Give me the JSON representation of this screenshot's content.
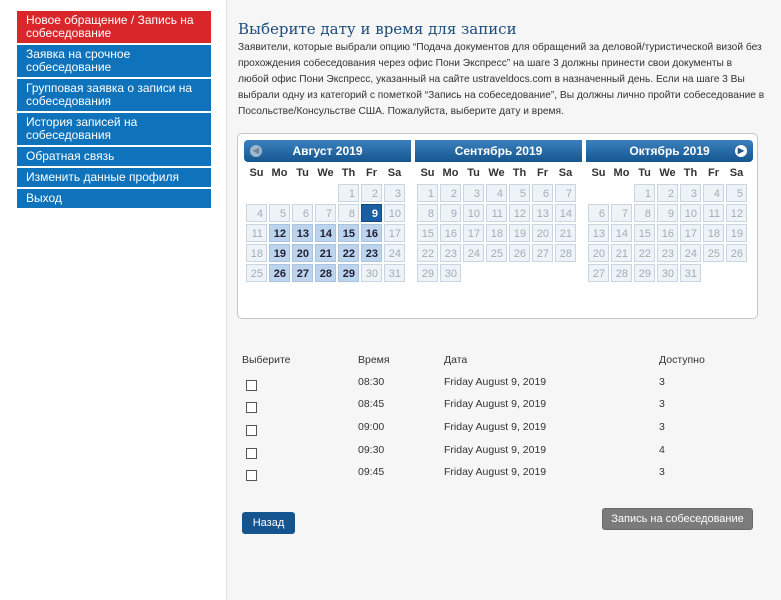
{
  "sidebar": {
    "items": [
      {
        "label": "Новое обращение / Запись на собеседование",
        "active": true
      },
      {
        "label": "Заявка на срочное собеседование",
        "active": false
      },
      {
        "label": "Групповая заявка о записи на собеседования",
        "active": false
      },
      {
        "label": "История записей на собеседования",
        "active": false
      },
      {
        "label": "Обратная связь",
        "active": false
      },
      {
        "label": "Изменить данные профиля",
        "active": false
      },
      {
        "label": "Выход",
        "active": false
      }
    ]
  },
  "main": {
    "title": "Выберите дату и время для записи",
    "description": "Заявители, которые выбрали опцию “Подача документов для обращений за деловой/туристической визой без прохождения собеседования через офис Пони Экспресс” на шаге 3 должны принести свои документы в любой офис Пони Экспресс, указанный на сайте ustraveldocs.com в назначенный день. Если на шаге 3 Вы выбрали одну из категорий с пометкой “Запись на собеседование”, Вы должны лично пройти собеседование в Посольстве/Консульстве США. Пожалуйста, выберите дату и время."
  },
  "calendar": {
    "weekdays": [
      "Su",
      "Mo",
      "Tu",
      "We",
      "Th",
      "Fr",
      "Sa"
    ],
    "months": [
      {
        "title": "Август 2019",
        "first_weekday": 4,
        "days_in_month": 31,
        "available": [
          12,
          13,
          14,
          15,
          16,
          19,
          20,
          21,
          22,
          23,
          26,
          27,
          28,
          29
        ],
        "selected": 9
      },
      {
        "title": "Сентябрь 2019",
        "first_weekday": 0,
        "days_in_month": 30,
        "available": [],
        "selected": null
      },
      {
        "title": "Октябрь 2019",
        "first_weekday": 2,
        "days_in_month": 31,
        "available": [],
        "selected": null
      }
    ],
    "prev_icon": "circle-arrow-left-icon",
    "next_icon": "circle-arrow-right-icon"
  },
  "slots": {
    "headers": {
      "select": "Выберите",
      "time": "Время",
      "date": "Дата",
      "available": "Доступно"
    },
    "rows": [
      {
        "time": "08:30",
        "date": "Friday August 9, 2019",
        "available": "3"
      },
      {
        "time": "08:45",
        "date": "Friday August 9, 2019",
        "available": "3"
      },
      {
        "time": "09:00",
        "date": "Friday August 9, 2019",
        "available": "3"
      },
      {
        "time": "09:30",
        "date": "Friday August 9, 2019",
        "available": "4"
      },
      {
        "time": "09:45",
        "date": "Friday August 9, 2019",
        "available": "3"
      }
    ]
  },
  "buttons": {
    "back": "Назад",
    "book": "Запись на собеседование"
  },
  "colors": {
    "sidebar_bg": "#0e73bb",
    "sidebar_active": "#d9262a",
    "title": "#1d4b7c",
    "calendar_header": "#15568f",
    "day_available": "#bcd4ee",
    "day_selected": "#1a5ea3",
    "day_unavailable": "#eef3f8"
  }
}
